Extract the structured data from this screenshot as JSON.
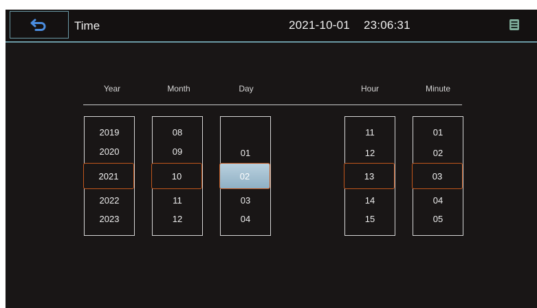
{
  "header": {
    "title": "Time",
    "date": "2021-10-01",
    "time": "23:06:31"
  },
  "columns": [
    {
      "label": "Year",
      "items": [
        "2019",
        "2020",
        "2021",
        "2022",
        "2023"
      ],
      "selected": "2021"
    },
    {
      "label": "Month",
      "items": [
        "08",
        "09",
        "10",
        "11",
        "12"
      ],
      "selected": "10"
    },
    {
      "label": "Day",
      "items": [
        "",
        "01",
        "02",
        "03",
        "04"
      ],
      "selected": "02"
    },
    {
      "label": "Hour",
      "items": [
        "11",
        "12",
        "13",
        "14",
        "15"
      ],
      "selected": "13"
    },
    {
      "label": "Minute",
      "items": [
        "01",
        "02",
        "03",
        "04",
        "05"
      ],
      "selected": "03"
    }
  ],
  "icons": {
    "back": "back-arrow-icon",
    "status": "card-icon"
  },
  "colors": {
    "background": "#191616",
    "accent": "#6b9aa6",
    "selection_border": "#c2561c",
    "active_fill": "#9fbccd"
  }
}
